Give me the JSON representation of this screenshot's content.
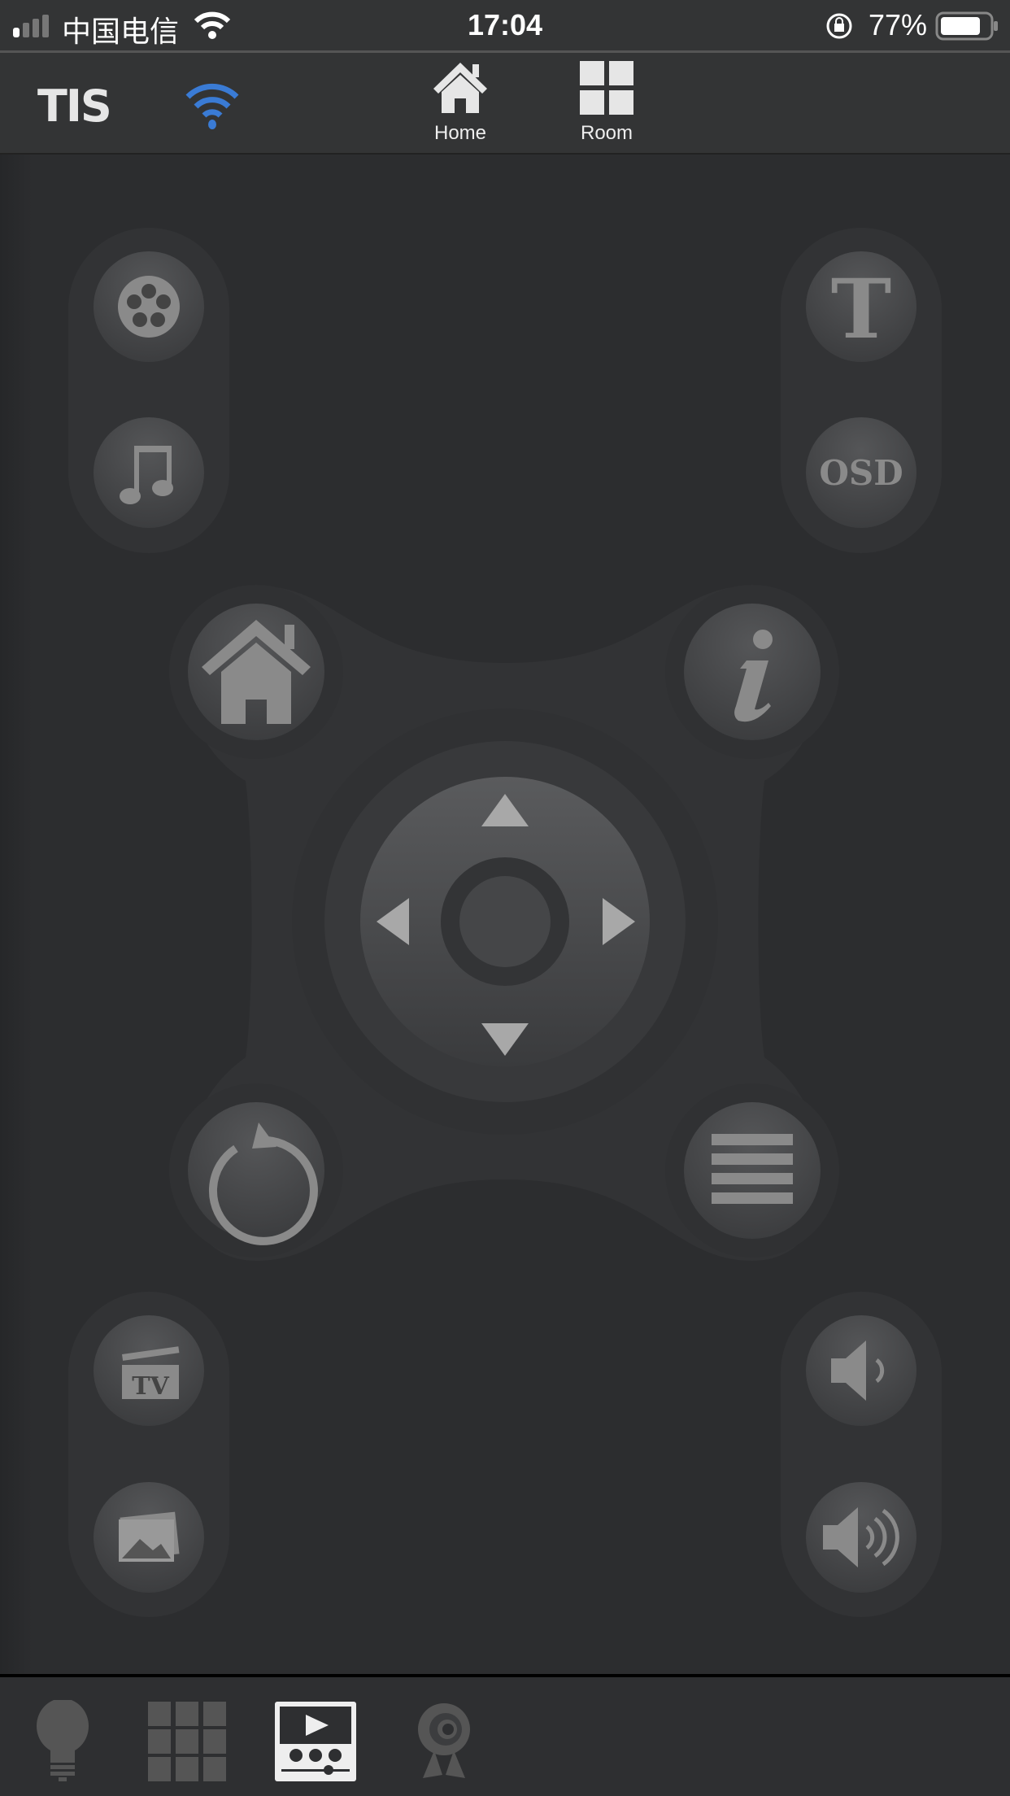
{
  "status_bar": {
    "carrier": "中国电信",
    "time": "17:04",
    "battery": "77%"
  },
  "header": {
    "logo": "TIS",
    "nav": [
      {
        "label": "Home",
        "icon": "home-icon"
      },
      {
        "label": "Room",
        "icon": "grid-icon"
      }
    ],
    "wifi_color": "#3a7bd5"
  },
  "remote": {
    "left_top": [
      "film-reel-icon",
      "music-note-icon"
    ],
    "right_top": {
      "text_button": "T",
      "osd_button": "OSD"
    },
    "corners": [
      "home-icon",
      "info-icon",
      "back-icon",
      "menu-icon"
    ],
    "dpad": [
      "up",
      "left",
      "ok",
      "right",
      "down"
    ],
    "left_bottom": [
      "tv-clapper-icon",
      "picture-icon"
    ],
    "right_bottom": [
      "volume-down-icon",
      "volume-up-icon"
    ],
    "tv_label": "TV"
  },
  "bottom_tabs": [
    {
      "icon": "light-bulb-icon",
      "active": false
    },
    {
      "icon": "grid-icon",
      "active": false
    },
    {
      "icon": "media-player-icon",
      "active": true
    },
    {
      "icon": "camera-icon",
      "active": false
    }
  ]
}
